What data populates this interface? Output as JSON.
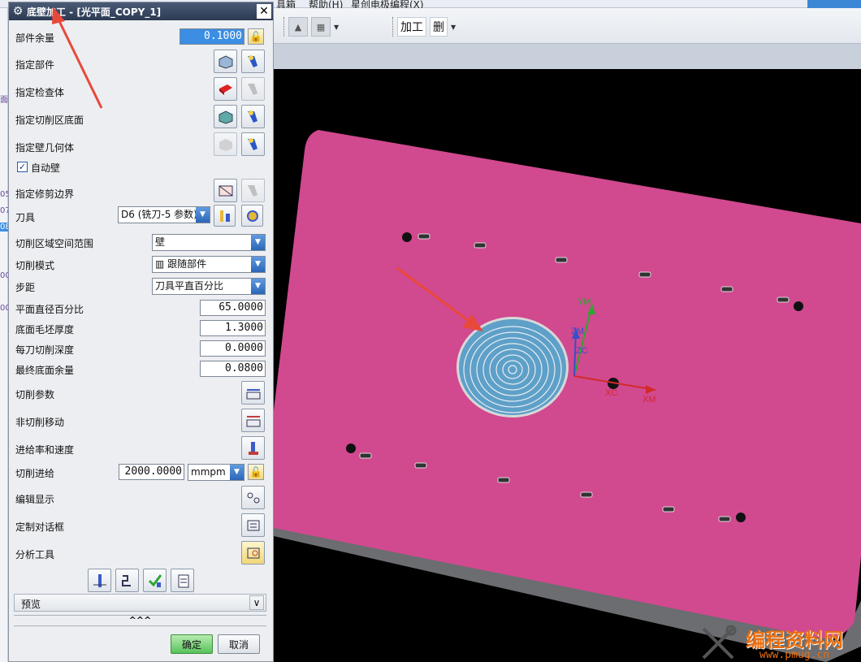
{
  "app": {
    "menus": [
      "具箱",
      "帮助(H)",
      "星创电极编程(X)"
    ],
    "toolbar_text": [
      "加工",
      "删"
    ]
  },
  "left_strip": [
    "面",
    "05",
    "07",
    "08",
    "00",
    "00"
  ],
  "dialog": {
    "title": "底壁加工 - [光平面_COPY_1]",
    "rows": {
      "part_stock_label": "部件余量",
      "part_stock_value": "0.1000",
      "specify_part": "指定部件",
      "specify_check": "指定检查体",
      "specify_floor": "指定切削区底面",
      "specify_wall": "指定壁几何体",
      "auto_wall": "自动壁",
      "trim_boundary": "指定修剪边界",
      "tool_label": "刀具",
      "tool_value": "D6 (铣刀-5 参数)",
      "cut_region_label": "切削区域空间范围",
      "cut_region_value": "壁",
      "cut_pattern_label": "切削模式",
      "cut_pattern_value": "跟随部件",
      "stepover_label": "步距",
      "stepover_value": "刀具平直百分比",
      "flat_diam_label": "平面直径百分比",
      "flat_diam_value": "65.0000",
      "floor_blank_label": "底面毛坯厚度",
      "floor_blank_value": "1.3000",
      "depth_per_cut_label": "每刀切削深度",
      "depth_per_cut_value": "0.0000",
      "final_floor_label": "最终底面余量",
      "final_floor_value": "0.0800",
      "cut_params": "切削参数",
      "non_cut_moves": "非切削移动",
      "feeds_speeds": "进给率和速度",
      "cut_feed_label": "切削进给",
      "cut_feed_value": "2000.0000",
      "cut_feed_unit": "mmpm",
      "edit_display": "编辑显示",
      "custom_dialog": "定制对话框",
      "analysis_tools": "分析工具"
    },
    "preview": "预览",
    "collapse": "^^^",
    "ok": "确定",
    "cancel": "取消"
  },
  "viewport": {
    "axis_labels": [
      "YM",
      "ZM",
      "ZC",
      "XC",
      "XM"
    ],
    "colors": {
      "plate": "#d1498f",
      "background": "#000000",
      "annotation_arrow": "#e8493a"
    }
  },
  "watermark": {
    "title": "编程资料网",
    "url": "www.pmug.cn"
  }
}
